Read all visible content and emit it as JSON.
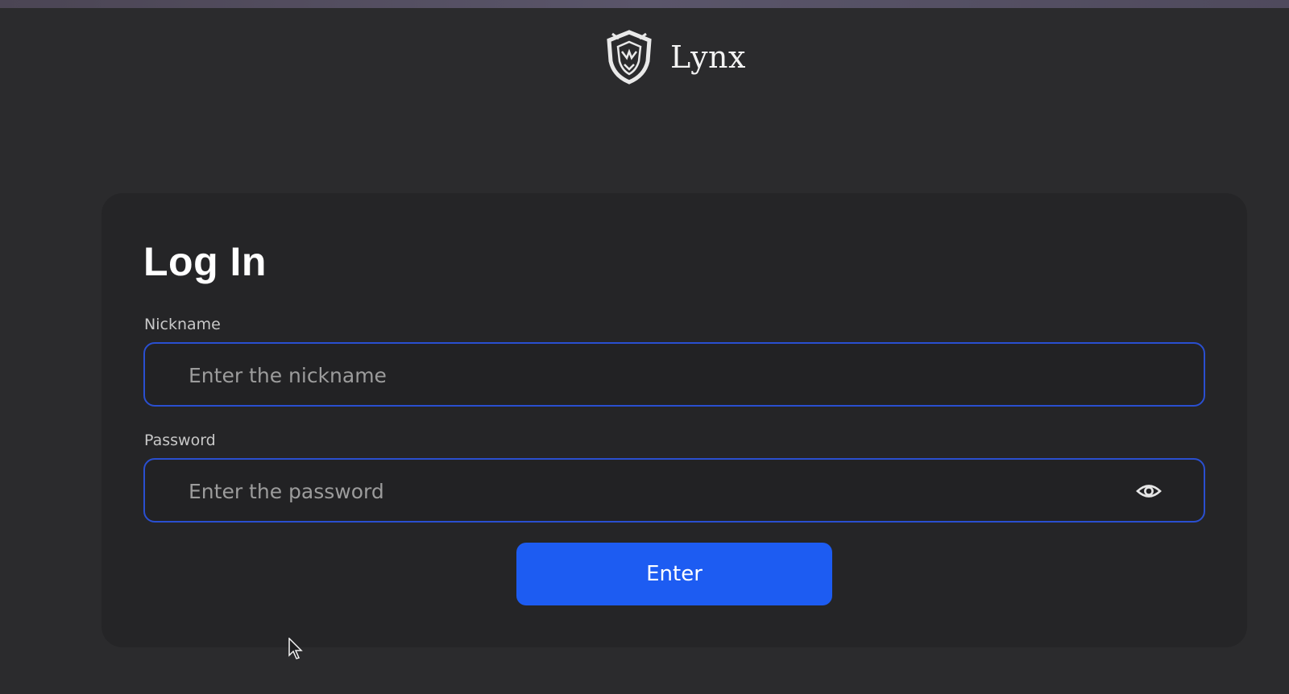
{
  "app": {
    "brand_name": "Lynx"
  },
  "login": {
    "title": "Log In",
    "nickname_label": "Nickname",
    "nickname_placeholder": "Enter the nickname",
    "nickname_value": "",
    "password_label": "Password",
    "password_placeholder": "Enter the password",
    "password_value": "",
    "submit_label": "Enter"
  },
  "icons": {
    "logo": "shield-crest-icon",
    "password_toggle": "eye-icon",
    "pointer": "mouse-cursor-icon"
  },
  "colors": {
    "background": "#2b2b2d",
    "card": "#252527",
    "field_border": "#2a4fd0",
    "button": "#1d5cf2",
    "text": "#ffffff",
    "placeholder": "#9c9c9c"
  }
}
